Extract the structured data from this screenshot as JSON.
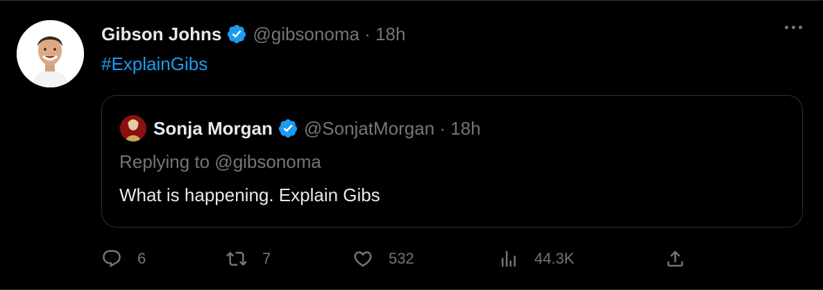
{
  "tweet": {
    "author_name": "Gibson Johns",
    "author_meta": "@gibsonoma · 18h",
    "hashtag": "#ExplainGibs",
    "more_icon": "more-horizontal-icon"
  },
  "quoted_tweet": {
    "author_name": "Sonja Morgan",
    "author_meta": "@SonjatMorgan · 18h",
    "replying_to": "Replying to @gibsonoma",
    "text": "What is happening. Explain Gibs"
  },
  "actions": {
    "replies": "6",
    "retweets": "7",
    "likes": "532",
    "views": "44.3K"
  },
  "colors": {
    "background": "#000000",
    "text": "#e7e9ea",
    "secondary": "#71767b",
    "accent": "#1d9bf0",
    "border": "#2f3336"
  }
}
